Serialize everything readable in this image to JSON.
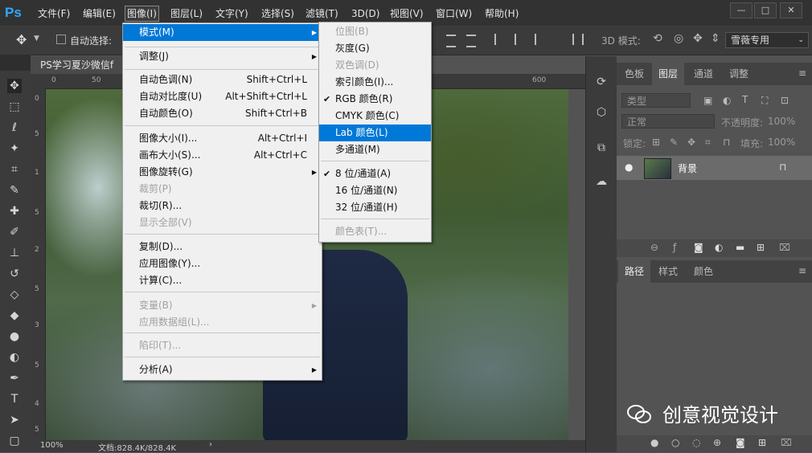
{
  "app": {
    "logo": "Ps"
  },
  "menubar": {
    "items": [
      "文件(F)",
      "编辑(E)",
      "图像(I)",
      "图层(L)",
      "文字(Y)",
      "选择(S)",
      "滤镜(T)",
      "3D(D)",
      "视图(V)",
      "窗口(W)",
      "帮助(H)"
    ]
  },
  "options": {
    "auto_select": "自动选择:",
    "mode_3d": "3D 模式:",
    "preset": "雪薇专用"
  },
  "document": {
    "tab": "PS学习夏沙微信f",
    "zoom": "100%",
    "doc_info": "文档:828.4K/828.4K",
    "ruler_h": [
      "0",
      "50",
      "600"
    ],
    "ruler_v": [
      "0",
      "5",
      "1",
      "5",
      "2",
      "5",
      "3",
      "5",
      "4",
      "5"
    ]
  },
  "image_menu": {
    "items": [
      {
        "label": "模式(M)",
        "shortcut": "",
        "submenu": true,
        "disabled": false,
        "highlight": true
      },
      {
        "label": "调整(J)",
        "shortcut": "",
        "submenu": true,
        "disabled": false
      },
      {
        "label": "自动色调(N)",
        "shortcut": "Shift+Ctrl+L",
        "submenu": false,
        "disabled": false
      },
      {
        "label": "自动对比度(U)",
        "shortcut": "Alt+Shift+Ctrl+L",
        "submenu": false,
        "disabled": false
      },
      {
        "label": "自动颜色(O)",
        "shortcut": "Shift+Ctrl+B",
        "submenu": false,
        "disabled": false
      },
      {
        "label": "图像大小(I)...",
        "shortcut": "Alt+Ctrl+I",
        "submenu": false,
        "disabled": false
      },
      {
        "label": "画布大小(S)...",
        "shortcut": "Alt+Ctrl+C",
        "submenu": false,
        "disabled": false
      },
      {
        "label": "图像旋转(G)",
        "shortcut": "",
        "submenu": true,
        "disabled": false
      },
      {
        "label": "裁剪(P)",
        "shortcut": "",
        "submenu": false,
        "disabled": true
      },
      {
        "label": "裁切(R)...",
        "shortcut": "",
        "submenu": false,
        "disabled": false
      },
      {
        "label": "显示全部(V)",
        "shortcut": "",
        "submenu": false,
        "disabled": true
      },
      {
        "label": "复制(D)...",
        "shortcut": "",
        "submenu": false,
        "disabled": false
      },
      {
        "label": "应用图像(Y)...",
        "shortcut": "",
        "submenu": false,
        "disabled": false
      },
      {
        "label": "计算(C)...",
        "shortcut": "",
        "submenu": false,
        "disabled": false
      },
      {
        "label": "变量(B)",
        "shortcut": "",
        "submenu": true,
        "disabled": true
      },
      {
        "label": "应用数据组(L)...",
        "shortcut": "",
        "submenu": false,
        "disabled": true
      },
      {
        "label": "陷印(T)...",
        "shortcut": "",
        "submenu": false,
        "disabled": true
      },
      {
        "label": "分析(A)",
        "shortcut": "",
        "submenu": true,
        "disabled": false
      }
    ]
  },
  "mode_menu": {
    "items": [
      {
        "label": "位图(B)",
        "disabled": true,
        "checked": false
      },
      {
        "label": "灰度(G)",
        "disabled": false,
        "checked": false
      },
      {
        "label": "双色调(D)",
        "disabled": true,
        "checked": false
      },
      {
        "label": "索引颜色(I)...",
        "disabled": false,
        "checked": false
      },
      {
        "label": "RGB 颜色(R)",
        "disabled": false,
        "checked": true
      },
      {
        "label": "CMYK 颜色(C)",
        "disabled": false,
        "checked": false
      },
      {
        "label": "Lab 颜色(L)",
        "disabled": false,
        "checked": false,
        "highlight": true
      },
      {
        "label": "多通道(M)",
        "disabled": false,
        "checked": false
      },
      {
        "label": "8 位/通道(A)",
        "disabled": false,
        "checked": true
      },
      {
        "label": "16 位/通道(N)",
        "disabled": false,
        "checked": false
      },
      {
        "label": "32 位/通道(H)",
        "disabled": false,
        "checked": false
      },
      {
        "label": "颜色表(T)...",
        "disabled": true,
        "checked": false
      }
    ]
  },
  "panels": {
    "top_tabs": [
      "色板",
      "图层",
      "通道",
      "调整"
    ],
    "kind": "类型",
    "blend_mode": "正常",
    "opacity_label": "不透明度:",
    "opacity": "100%",
    "lock_label": "锁定:",
    "fill_label": "填充:",
    "fill": "100%",
    "layer_name": "背景",
    "bottom_tabs": [
      "路径",
      "样式",
      "颜色"
    ]
  },
  "watermark": {
    "text": "创意视觉设计"
  },
  "colors": {
    "menu_highlight": "#0078d7",
    "ps_blue": "#31a8ff"
  }
}
